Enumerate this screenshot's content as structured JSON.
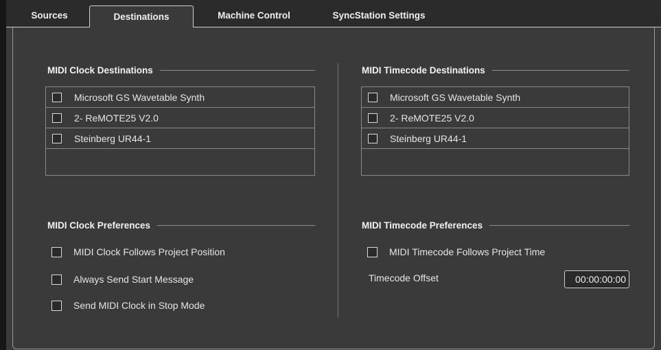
{
  "tabs": [
    {
      "label": "Sources",
      "active": false
    },
    {
      "label": "Destinations",
      "active": true
    },
    {
      "label": "Machine Control",
      "active": false
    },
    {
      "label": "SyncStation Settings",
      "active": false
    }
  ],
  "midi_clock_destinations": {
    "title": "MIDI Clock Destinations",
    "items": [
      {
        "label": "Microsoft GS Wavetable Synth",
        "checked": false
      },
      {
        "label": "2- ReMOTE25 V2.0",
        "checked": false
      },
      {
        "label": "Steinberg UR44-1",
        "checked": false
      }
    ]
  },
  "midi_timecode_destinations": {
    "title": "MIDI Timecode Destinations",
    "items": [
      {
        "label": "Microsoft GS Wavetable Synth",
        "checked": false
      },
      {
        "label": "2- ReMOTE25 V2.0",
        "checked": false
      },
      {
        "label": "Steinberg UR44-1",
        "checked": false
      }
    ]
  },
  "midi_clock_preferences": {
    "title": "MIDI Clock Preferences",
    "items": [
      {
        "label": "MIDI Clock Follows Project Position",
        "checked": false
      },
      {
        "label": "Always Send Start Message",
        "checked": false
      },
      {
        "label": "Send MIDI Clock in Stop Mode",
        "checked": false
      }
    ]
  },
  "midi_timecode_preferences": {
    "title": "MIDI Timecode Preferences",
    "follows_label": "MIDI Timecode Follows Project Time",
    "follows_checked": false,
    "offset_label": "Timecode Offset",
    "offset_value": "00:00:00:00"
  }
}
